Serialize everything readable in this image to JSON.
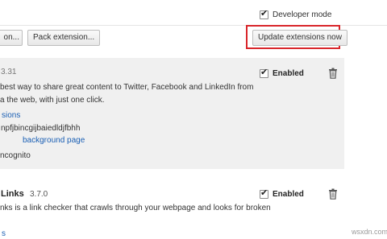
{
  "header": {
    "developer_mode_label": "Developer mode",
    "developer_mode_checked": true
  },
  "toolbar": {
    "load_unpacked_label": "on...",
    "pack_extension_label": "Pack extension...",
    "update_now_label": "Update extensions now",
    "highlight_color": "#d9252a"
  },
  "extensions": [
    {
      "version": "3.31",
      "description_line1": " best way to share great content to Twitter, Facebook and LinkedIn from",
      "description_line2": "a the web, with just one click.",
      "details_link": "sions",
      "id": "npfjbincgijbaiedldjfbhh",
      "background_label": "background page",
      "incognito_label": "ncognito",
      "enabled_label": "Enabled",
      "enabled": true
    },
    {
      "name": "Links",
      "version": "3.7.0",
      "description_line1": "nks is a link checker that crawls through your webpage and looks for broken",
      "details_link": "s",
      "enabled_label": "Enabled",
      "enabled": true
    }
  ],
  "watermark": "wsxdn.com",
  "colors": {
    "card_bg": "#f0f0f0",
    "link": "#1a5fb4"
  }
}
